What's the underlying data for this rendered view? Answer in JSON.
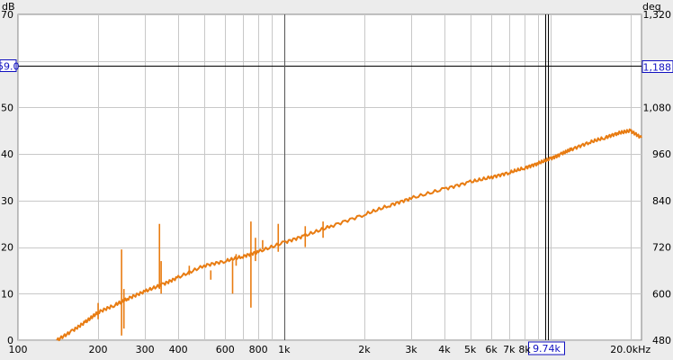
{
  "chart_data": {
    "type": "line",
    "xscale": "log",
    "xlim": [
      100,
      22000
    ],
    "ylim_left": [
      0,
      70
    ],
    "ylim_right": [
      480,
      1320
    ],
    "left_unit": "dB",
    "right_unit": "deg",
    "x_ticks": [
      {
        "v": 100,
        "label": "100"
      },
      {
        "v": 200,
        "label": "200"
      },
      {
        "v": 300,
        "label": "300"
      },
      {
        "v": 400,
        "label": "400"
      },
      {
        "v": 600,
        "label": "600"
      },
      {
        "v": 800,
        "label": "800"
      },
      {
        "v": 1000,
        "label": "1k"
      },
      {
        "v": 2000,
        "label": "2k"
      },
      {
        "v": 3000,
        "label": "3k"
      },
      {
        "v": 4000,
        "label": "4k"
      },
      {
        "v": 5000,
        "label": "5k"
      },
      {
        "v": 6000,
        "label": "6k"
      },
      {
        "v": 7000,
        "label": "7k"
      },
      {
        "v": 8000,
        "label": "8k"
      },
      {
        "v": 20000,
        "label": "20.0kHz"
      }
    ],
    "x_minor": [
      500,
      700,
      900,
      9000,
      10000
    ],
    "y_left_ticks": [
      {
        "v": 70,
        "label": "70"
      },
      {
        "v": 50,
        "label": "50"
      },
      {
        "v": 40,
        "label": "40"
      },
      {
        "v": 30,
        "label": "30"
      },
      {
        "v": 20,
        "label": "20"
      },
      {
        "v": 10,
        "label": "10"
      },
      {
        "v": 0,
        "label": "0"
      }
    ],
    "y_right_ticks": [
      {
        "v": 1320,
        "label": "1,320"
      },
      {
        "v": 1080,
        "label": "1,080"
      },
      {
        "v": 960,
        "label": "960"
      },
      {
        "v": 840,
        "label": "840"
      },
      {
        "v": 720,
        "label": "720"
      },
      {
        "v": 600,
        "label": "600"
      },
      {
        "v": 480,
        "label": "480"
      }
    ],
    "hcursor": {
      "value_left": 59.0,
      "label_left": "59.0",
      "label_right": "1,188"
    },
    "vcursor": {
      "value": 9740,
      "label": "9.74k"
    },
    "secondary_vline": 1000,
    "series": [
      {
        "color": "#e87c12",
        "x": [
          140,
          160,
          180,
          200,
          230,
          260,
          300,
          350,
          400,
          500,
          600,
          700,
          800,
          1000,
          1200,
          1500,
          2000,
          2500,
          3000,
          4000,
          5000,
          6000,
          7000,
          8000,
          9000,
          10000,
          11000,
          12000,
          14000,
          16000,
          18000,
          20000,
          22000
        ],
        "y": [
          0,
          2,
          4,
          6,
          7.5,
          9,
          10.5,
          12,
          13.5,
          16,
          17,
          18,
          19,
          21,
          22.5,
          24.5,
          27,
          29,
          30.5,
          32.5,
          34,
          35,
          36,
          37,
          38,
          39,
          40,
          41,
          42.5,
          43.5,
          44.5,
          45,
          43.5
        ]
      }
    ],
    "spikes": [
      {
        "x": 200,
        "top": 8,
        "bottom": 4.5
      },
      {
        "x": 245,
        "top": 19.5,
        "bottom": 1
      },
      {
        "x": 250,
        "top": 11,
        "bottom": 2.5
      },
      {
        "x": 340,
        "top": 25,
        "bottom": 11
      },
      {
        "x": 345,
        "top": 17,
        "bottom": 10
      },
      {
        "x": 440,
        "top": 16,
        "bottom": 14
      },
      {
        "x": 530,
        "top": 13,
        "bottom": 15
      },
      {
        "x": 640,
        "top": 17,
        "bottom": 10
      },
      {
        "x": 660,
        "top": 18.5,
        "bottom": 16
      },
      {
        "x": 750,
        "top": 25.5,
        "bottom": 7
      },
      {
        "x": 780,
        "top": 22,
        "bottom": 17
      },
      {
        "x": 830,
        "top": 21.5,
        "bottom": 19.5
      },
      {
        "x": 950,
        "top": 25,
        "bottom": 19
      },
      {
        "x": 1200,
        "top": 24.5,
        "bottom": 20
      },
      {
        "x": 1400,
        "top": 25.5,
        "bottom": 22
      }
    ]
  }
}
